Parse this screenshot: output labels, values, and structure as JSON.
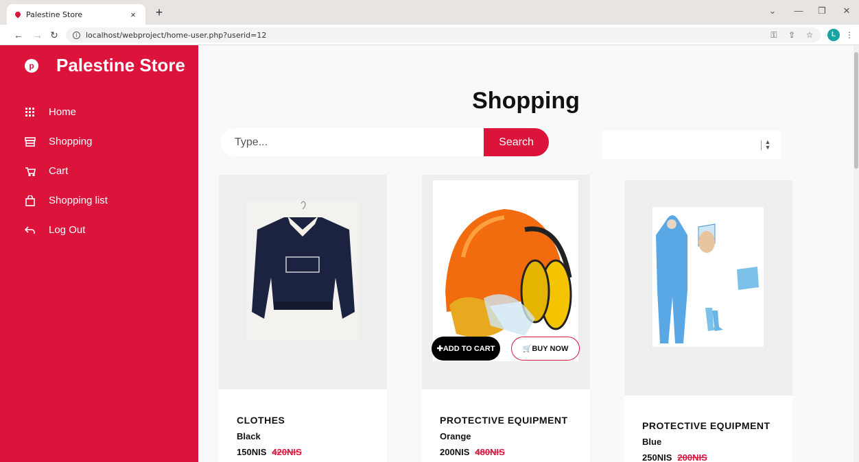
{
  "browser": {
    "tab_title": "Palestine Store",
    "tab_close": "×",
    "new_tab": "+",
    "url": "localhost/webproject/home-user.php?userid=12",
    "avatar_letter": "L"
  },
  "sidebar": {
    "brand": "Palestine Store",
    "items": [
      {
        "label": "Home",
        "icon": "grid-icon"
      },
      {
        "label": "Shopping",
        "icon": "store-icon"
      },
      {
        "label": "Cart",
        "icon": "cart-icon"
      },
      {
        "label": "Shopping list",
        "icon": "bag-icon"
      },
      {
        "label": "Log Out",
        "icon": "back-arrow-icon"
      }
    ]
  },
  "main": {
    "title": "Shopping",
    "search_placeholder": "Type...",
    "search_button": "Search",
    "filter_value": ""
  },
  "products": [
    {
      "name": "CLOTHES",
      "color": "Black",
      "price": "150NIS",
      "old_price": "420NIS"
    },
    {
      "name": "PROTECTIVE EQUIPMENT",
      "color": "Orange",
      "price": "200NIS",
      "old_price": "480NIS",
      "add_to_cart": "ADD TO CART",
      "buy_now": "BUY NOW"
    },
    {
      "name": "PROTECTIVE EQUIPMENT",
      "color": "Blue",
      "price": "250NIS",
      "old_price": "200NIS"
    }
  ],
  "colors": {
    "accent": "#dc143c",
    "background": "#f8f9fa"
  }
}
